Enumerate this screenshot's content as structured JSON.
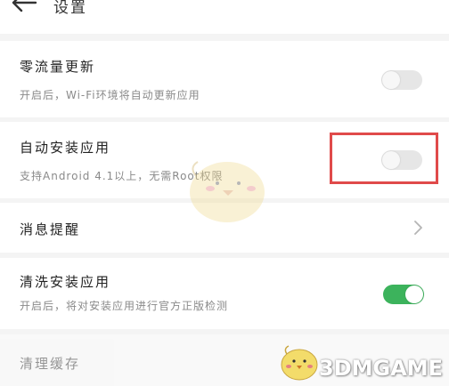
{
  "header": {
    "title": "设置",
    "back_icon": "arrow-left-icon"
  },
  "settings": [
    {
      "title": "零流量更新",
      "subtitle": "开启后，Wi-Fi环境将自动更新应用",
      "toggle": "off"
    },
    {
      "title": "自动安装应用",
      "subtitle": "支持Android 4.1以上，无需Root权限",
      "toggle": "off"
    },
    {
      "title": "消息提醒",
      "icon": "chevron-right-icon"
    },
    {
      "title": "清洗安装应用",
      "subtitle": "开启后，将对安装应用进行官方正版检测",
      "toggle": "on"
    },
    {
      "title": "清理缓存"
    }
  ],
  "colors": {
    "accent_green": "#3cb35c",
    "highlight_red": "#e04a4a",
    "background": "#f4f4f4"
  },
  "watermark": {
    "text": "3DMGAME",
    "mascot_icon": "chick-mascot-icon"
  }
}
